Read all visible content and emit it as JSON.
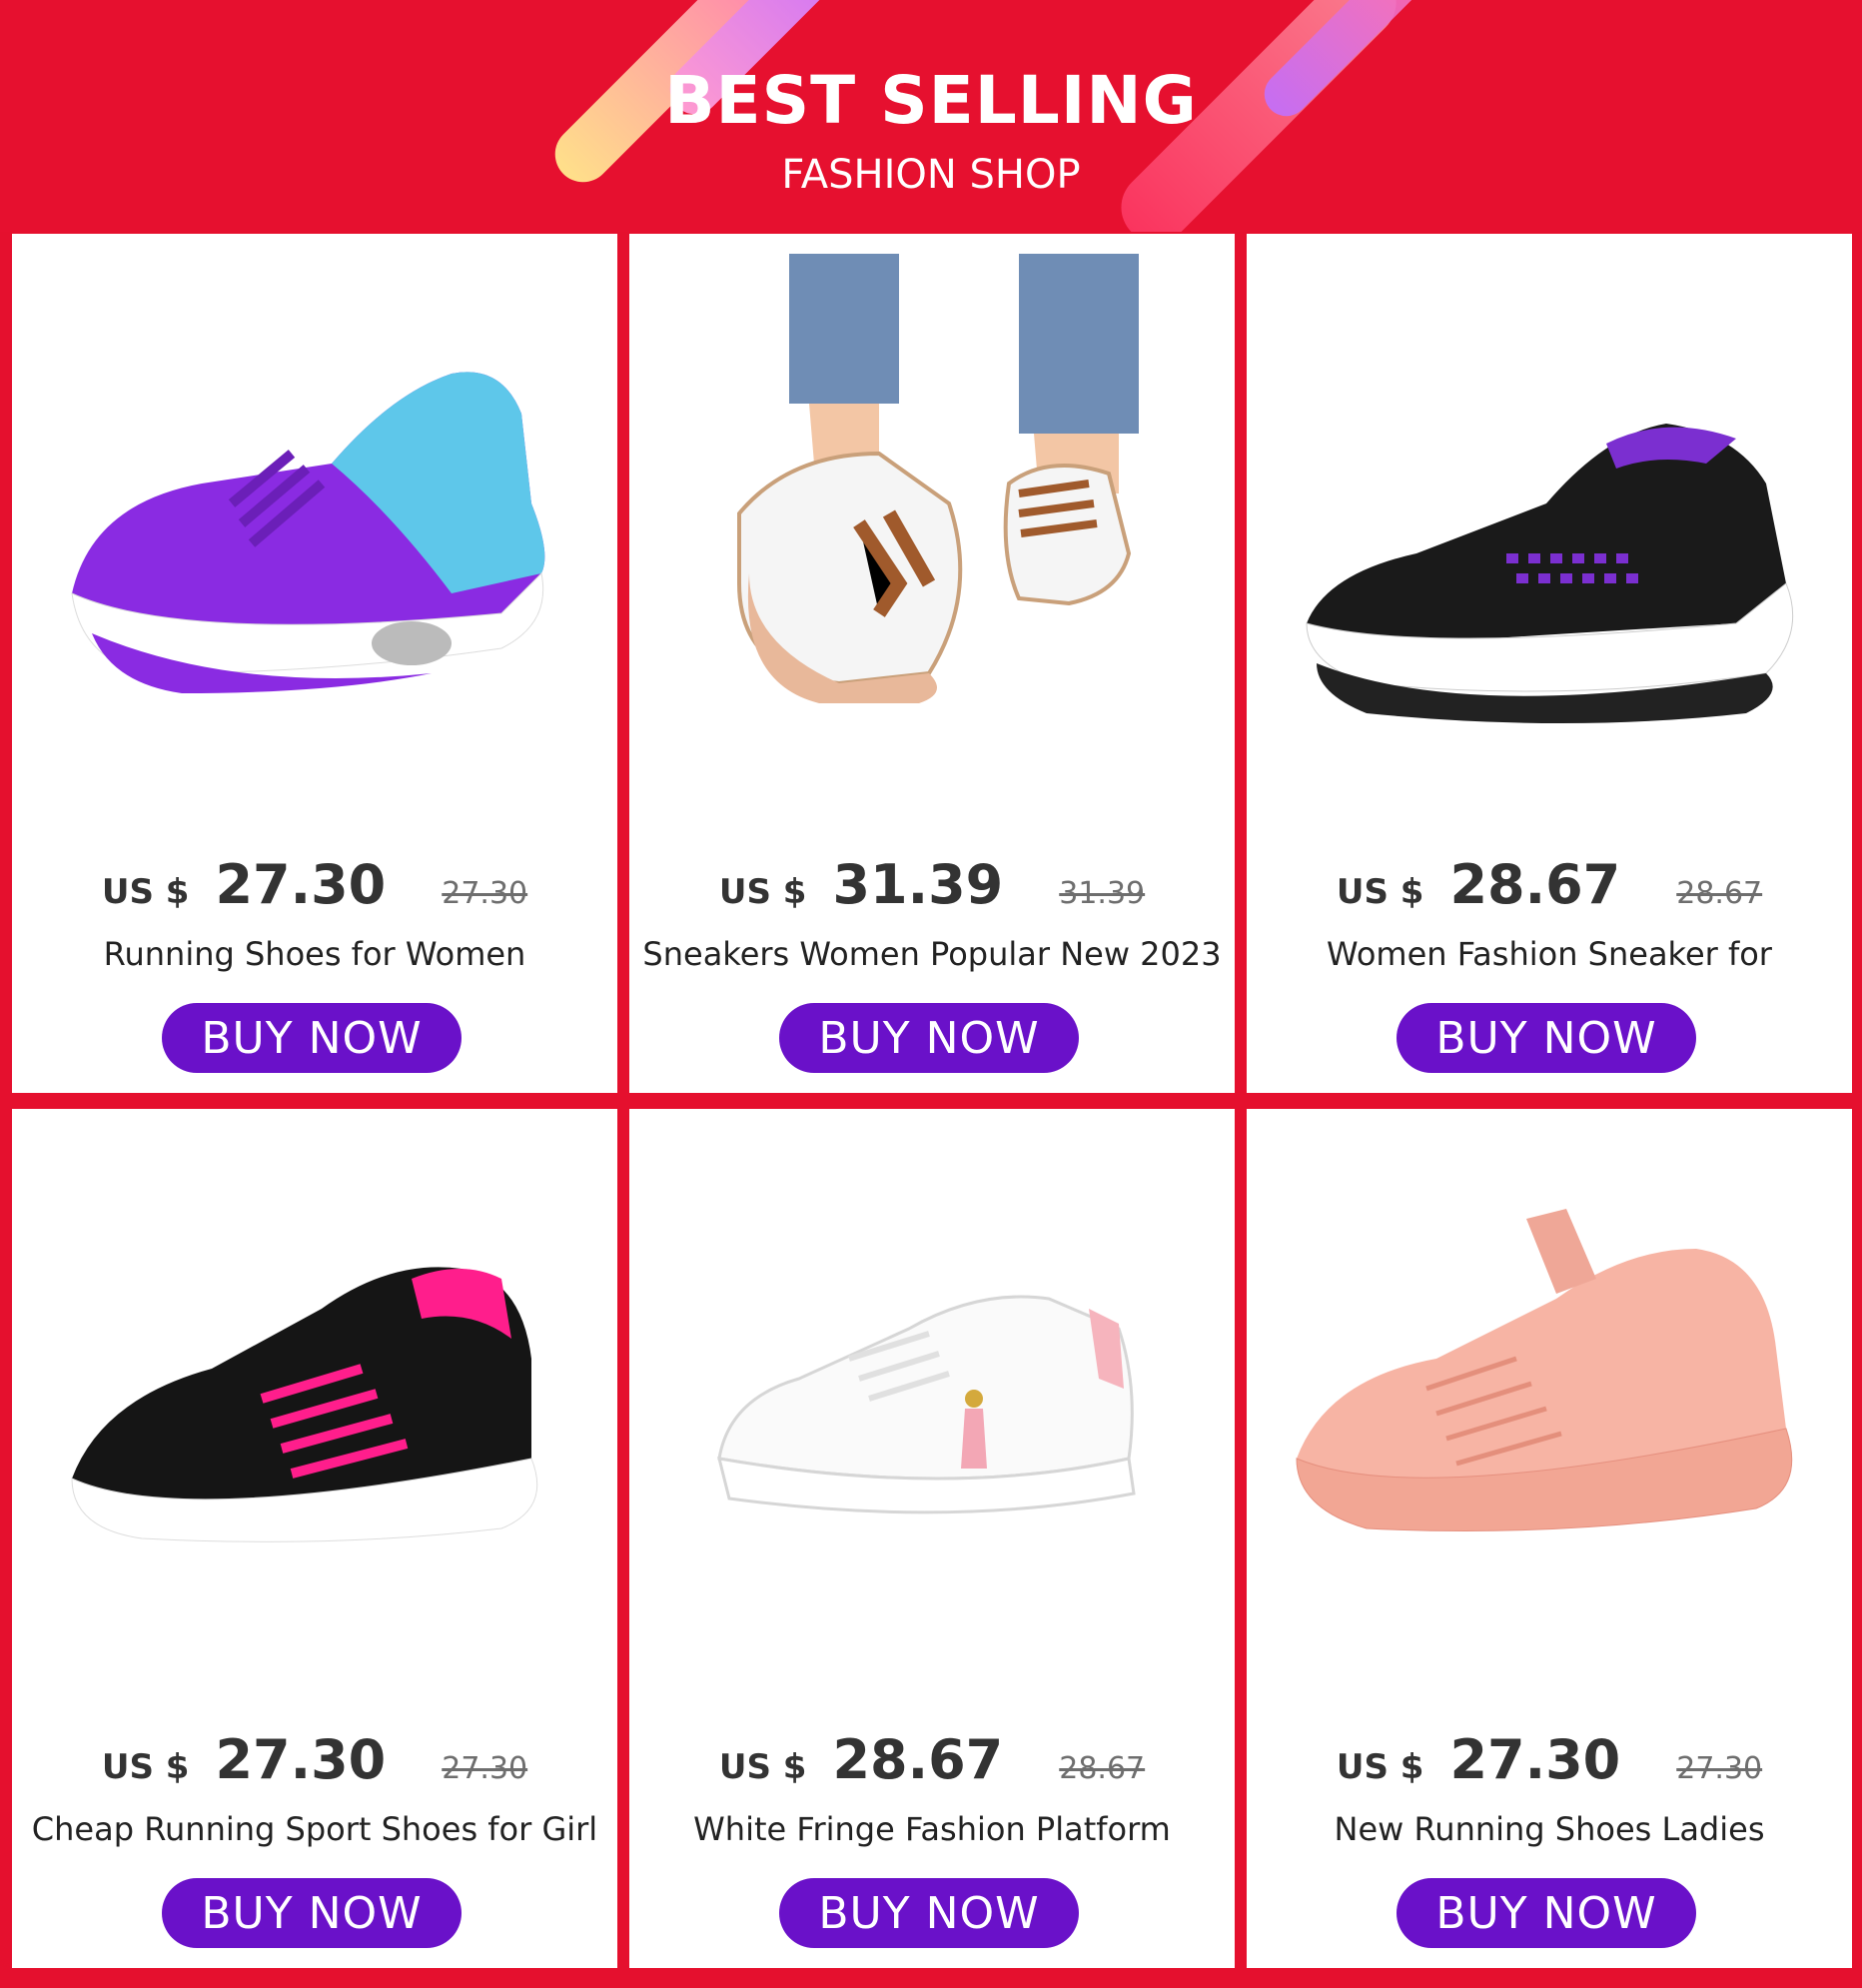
{
  "banner": {
    "title": "BEST SELLING",
    "subtitle": "FASHION SHOP"
  },
  "colors": {
    "background": "#e5102e",
    "button": "#6a11c9",
    "card": "#ffffff"
  },
  "products": [
    {
      "currency": "US $",
      "price": "27.30",
      "old_price": "27.30",
      "title": "Running Shoes for Women",
      "button": "BUY NOW",
      "image": "purple-blue-sneaker"
    },
    {
      "currency": "US $",
      "price": "31.39",
      "old_price": "31.39",
      "title": "Sneakers Women Popular New 2023",
      "button": "BUY NOW",
      "image": "white-brown-sneaker-worn"
    },
    {
      "currency": "US $",
      "price": "28.67",
      "old_price": "28.67",
      "title": "Women Fashion Sneaker for",
      "button": "BUY NOW",
      "image": "black-purple-sock-sneaker"
    },
    {
      "currency": "US $",
      "price": "27.30",
      "old_price": "27.30",
      "title": "Cheap Running Sport Shoes for Girl",
      "button": "BUY NOW",
      "image": "black-pink-sneaker"
    },
    {
      "currency": "US $",
      "price": "28.67",
      "old_price": "28.67",
      "title": "White Fringe Fashion Platform",
      "button": "BUY NOW",
      "image": "white-tassel-sneaker"
    },
    {
      "currency": "US $",
      "price": "27.30",
      "old_price": "27.30",
      "title": "New Running Shoes Ladies",
      "button": "BUY NOW",
      "image": "pink-knit-sneaker"
    }
  ]
}
